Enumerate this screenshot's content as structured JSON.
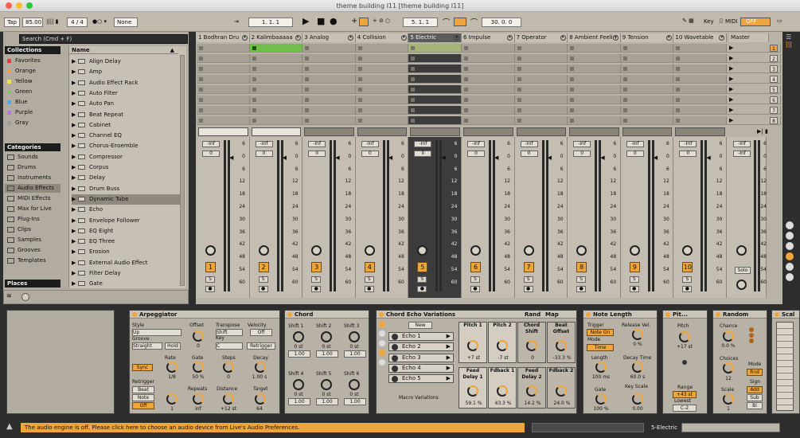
{
  "window": {
    "title": "theme building I11  [theme building I11]"
  },
  "control_bar": {
    "tap": "Tap",
    "tempo": "85.00",
    "meter": "4 / 4",
    "groove": "None",
    "position": "1.  1.  1",
    "loop_start": "5.  1.  1",
    "loop_length": "30.  0.  0",
    "key": "Key",
    "midi": "MIDI",
    "off": "OFF"
  },
  "browser": {
    "search_placeholder": "Search (Cmd + F)",
    "collections_title": "Collections",
    "collections": [
      {
        "label": "Favorites",
        "color": "#e23d3d"
      },
      {
        "label": "Orange",
        "color": "#f0a53a"
      },
      {
        "label": "Yellow",
        "color": "#f1e24a"
      },
      {
        "label": "Green",
        "color": "#6bcf6b"
      },
      {
        "label": "Blue",
        "color": "#5aa7e8"
      },
      {
        "label": "Purple",
        "color": "#b27ad6"
      },
      {
        "label": "Gray",
        "color": "#9e9e9e"
      }
    ],
    "categories_title": "Categories",
    "categories": [
      "Sounds",
      "Drums",
      "Instruments",
      "Audio Effects",
      "MIDI Effects",
      "Max for Live",
      "Plug-Ins",
      "Clips",
      "Samples",
      "Grooves",
      "Templates"
    ],
    "places_title": "Places",
    "name_header": "Name",
    "items": [
      "Align Delay",
      "Amp",
      "Audio Effect Rack",
      "Auto Filter",
      "Auto Pan",
      "Beat Repeat",
      "Cabinet",
      "Channel EQ",
      "Chorus-Ensemble",
      "Compressor",
      "Corpus",
      "Delay",
      "Drum Buss",
      "Dynamic Tube",
      "Echo",
      "Envelope Follower",
      "EQ Eight",
      "EQ Three",
      "Erosion",
      "External Audio Effect",
      "Filter Delay",
      "Gate"
    ]
  },
  "tracks": [
    {
      "name": "1 Bodhran Dru",
      "num": "1"
    },
    {
      "name": "2 Kalimbaaaaa",
      "num": "2"
    },
    {
      "name": "3 Analog",
      "num": "3"
    },
    {
      "name": "4 Collision",
      "num": "4"
    },
    {
      "name": "5 Electric",
      "num": "5"
    },
    {
      "name": "6 Impulse",
      "num": "6"
    },
    {
      "name": "7 Operator",
      "num": "7"
    },
    {
      "name": "8 Ambient Feelin",
      "num": "8"
    },
    {
      "name": "9 Tension",
      "num": "9"
    },
    {
      "name": "10 Wavetable",
      "num": "10"
    }
  ],
  "master": {
    "name": "Master",
    "solo": "Solo",
    "scenes": [
      "1",
      "2",
      "3",
      "4",
      "5",
      "6",
      "7",
      "8"
    ]
  },
  "mixer": {
    "inf": "-Inf",
    "zero": "0",
    "s": "S",
    "scale": [
      "6",
      "0",
      "6",
      "12",
      "18",
      "24",
      "30",
      "36",
      "42",
      "48",
      "54",
      "60"
    ]
  },
  "devices": {
    "arp": {
      "title": "Arpeggiator",
      "style": "Style",
      "style_val": "Up",
      "groove": "Groove",
      "groove_val": "Straight",
      "hold": "Hold",
      "offset": "Offset",
      "offset_val": "0",
      "transpose": "Transpose",
      "transpose_val": "Shift",
      "key": "Key",
      "key_val": "C",
      "velocity": "Velocity",
      "velocity_val": "Off",
      "retrigger_btn": "Retrigger",
      "sync": "Sync",
      "rate": "Rate",
      "rate_val": "1/8",
      "gate": "Gate",
      "gate_val": "50 %",
      "steps": "Steps",
      "steps_val": "0",
      "decay": "Decay",
      "decay_val": "1.00 s",
      "retrigger": "Retrigger",
      "beat": "Beat",
      "note": "Note",
      "off": "Off",
      "repeats": "Repeats",
      "repeats_val": "inf",
      "distance": "Distance",
      "distance_val": "+12 st",
      "target": "Target",
      "target_val": "64",
      "one": "1"
    },
    "chord": {
      "title": "Chord",
      "shifts": [
        "Shift 1",
        "Shift 2",
        "Shift 3",
        "Shift 4",
        "Shift 5",
        "Shift 6"
      ],
      "shift_val": "0 st",
      "vel": "1.00"
    },
    "echo_var": {
      "title": "Chord Echo Variations",
      "rand": "Rand",
      "map": "Map",
      "new": "New",
      "chains": [
        "Echo 1",
        "Echo 2",
        "Echo 3",
        "Echo 4",
        "Echo 5"
      ],
      "macro_label": "Macro Variations",
      "macros": [
        {
          "name": "Pitch 1",
          "val": "+7 st"
        },
        {
          "name": "Pitch 2",
          "val": "-7 st"
        },
        {
          "name": "Chord Shift",
          "val": "0"
        },
        {
          "name": "Beat Offset",
          "val": "-33.3 %"
        },
        {
          "name": "Feed Delay 1",
          "val": "59.1 %"
        },
        {
          "name": "Fdback 1",
          "val": "43.3 %"
        },
        {
          "name": "Feed Delay 2",
          "val": "14.2 %"
        },
        {
          "name": "Fdback 2",
          "val": "24.0 %"
        }
      ]
    },
    "note_length": {
      "title": "Note Length",
      "trigger": "Trigger",
      "trigger_val": "Note On",
      "release": "Release Vel.",
      "release_val": "0 %",
      "mode": "Mode",
      "mode_val": "Time",
      "length": "Length",
      "length_val": "100 ms",
      "decay": "Decay Time",
      "decay_val": "60.0 s",
      "gate": "Gate",
      "gate_val": "100 %",
      "key_scale": "Key Scale",
      "key_scale_val": "0.00"
    },
    "pitch": {
      "title": "Pit...",
      "pitch": "Pitch",
      "pitch_val": "+17 st",
      "range": "Range",
      "range_val": "+43 st",
      "lowest": "Lowest",
      "lowest_val": "C-2"
    },
    "random": {
      "title": "Random",
      "chance": "Chance",
      "chance_val": "0.0 %",
      "choices": "Choices",
      "choices_val": "12",
      "scale": "Scale",
      "scale_val": "1",
      "mode": "Mode",
      "mode_val": "Rnd",
      "sign": "Sign",
      "add": "Add",
      "sub": "Sub",
      "bi": "Bi"
    },
    "scale": {
      "title": "Scal"
    }
  },
  "status": {
    "message": "The audio engine is off. Please click here to choose an audio device from Live's Audio Preferences.",
    "track": "5-Electric"
  }
}
